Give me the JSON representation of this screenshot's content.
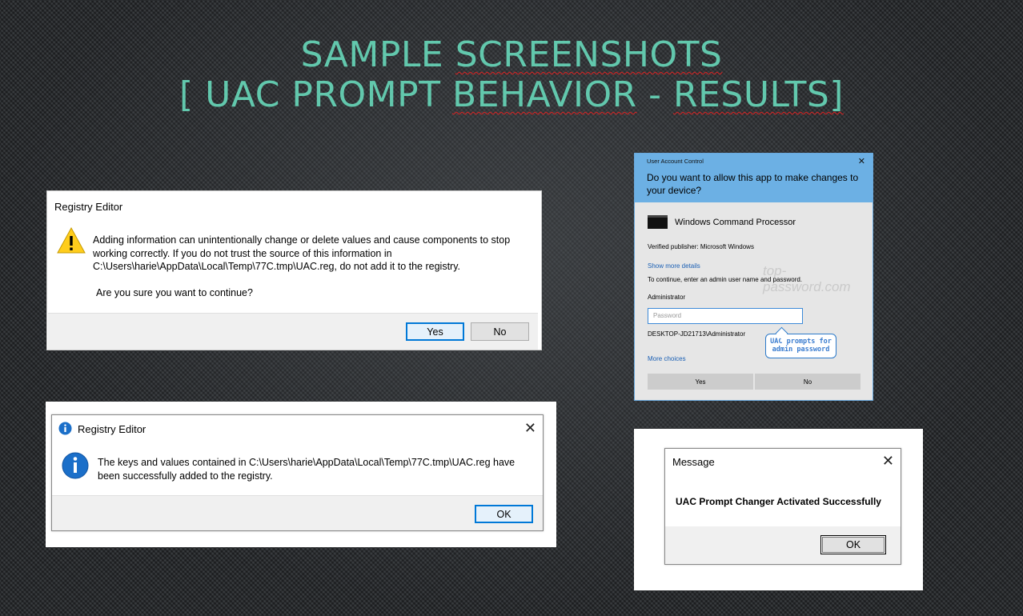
{
  "slide": {
    "title_line1_a": "Sample ",
    "title_line1_b": "Screenshots",
    "title_line2_a": "[ UAC Prompt ",
    "title_line2_b": "Behavior",
    "title_line2_c": " - ",
    "title_line2_d": "Results]"
  },
  "registry_warning": {
    "title": "Registry Editor",
    "icon": "warning-icon",
    "message": "Adding information can unintentionally change or delete values and cause components to stop working correctly. If you do not trust the source of this information in C:\\Users\\harie\\AppData\\Local\\Temp\\77C.tmp\\UAC.reg, do not add it to the registry.",
    "question": "Are you sure you want to continue?",
    "yes_label": "Yes",
    "no_label": "No"
  },
  "registry_info": {
    "title": "Registry Editor",
    "icon": "info-icon",
    "message": "The keys and values contained in C:\\Users\\harie\\AppData\\Local\\Temp\\77C.tmp\\UAC.reg have been successfully added to the registry.",
    "ok_label": "OK"
  },
  "uac": {
    "header_label": "User Account Control",
    "question": "Do you want to allow this app to make changes to your device?",
    "app_name": "Windows Command Processor",
    "publisher": "Verified publisher: Microsoft Windows",
    "show_details": "Show more details",
    "continue_text": "To continue, enter an admin user name and password.",
    "watermark": "top-password.com",
    "username": "Administrator",
    "password_placeholder": "Password",
    "machine_account": "DESKTOP-JD21713\\Administrator",
    "callout": "UAC prompts for admin password",
    "more_choices": "More choices",
    "yes_label": "Yes",
    "no_label": "No",
    "header_color": "#6cb0e4"
  },
  "message_box": {
    "title": "Message",
    "text": "UAC Prompt Changer Activated Successfully",
    "ok_label": "OK"
  },
  "colors": {
    "title_accent": "#62c8ad",
    "link": "#1a5fb4",
    "default_button_border": "#0078d7"
  }
}
